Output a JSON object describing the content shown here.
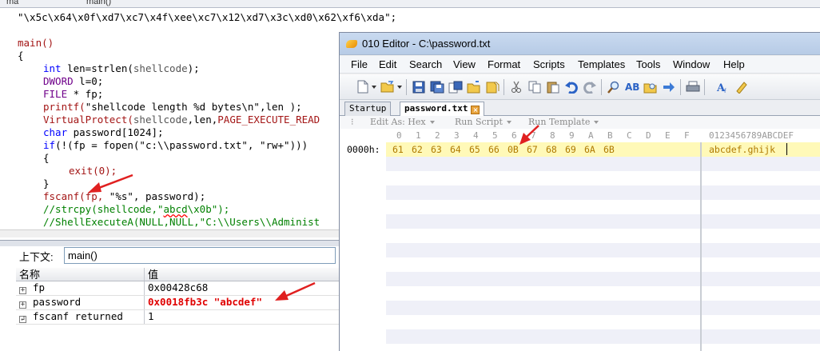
{
  "ide": {
    "topbar": {
      "item_a": "ma",
      "item_b": "main()"
    },
    "code_lines": {
      "l0": "\"\\x5c\\x64\\x0f\\xd7\\xc7\\x4f\\xee\\xc7\\x12\\xd7\\x3c\\xd0\\x62\\xf6\\xda\";",
      "l1": "main()",
      "l2": "{",
      "l3a": "int",
      "l3b": " len=strlen(",
      "l3c": "shellcode",
      "l3d": ");",
      "l4a": "DWORD",
      "l4b": " l=0;",
      "l5a": "FILE",
      "l5b": " * fp;",
      "l6a": "printf(",
      "l6b": "\"shellcode length %d bytes\\n\"",
      "l6c": ",len );",
      "l7a": "VirtualProtect(",
      "l7b": "shellcode",
      "l7c": ",len,",
      "l7d": "PAGE_EXECUTE_READ",
      "l8a": "char",
      "l8b": " password[1024];",
      "l9a": "if",
      "l9b": "(!(fp = fopen(",
      "l9c": "\"c:\\\\password.txt\"",
      "l9d": ", ",
      "l9e": "\"rw+\"",
      "l9f": ")))",
      "l10": "{",
      "l11": "exit(0);",
      "l12": "}",
      "l13a": "fscanf(fp, ",
      "l13b": "\"%s\"",
      "l13c": ", password);",
      "l14a": "//strcpy(shellcode,\"",
      "l14b": "abcd",
      "l14c": "\\x0b\");",
      "l15": "//ShellExecuteA(NULL,NULL,\"C:\\\\Users\\\\Administ"
    }
  },
  "locals": {
    "context_label": "上下文:",
    "context_value": "main()",
    "col_name": "名称",
    "col_value": "值",
    "rows": [
      {
        "name": "fp",
        "value": "0x00428c68",
        "highlight": false
      },
      {
        "name": "password",
        "value": "0x0018fb3c \"abcdef\"",
        "highlight": true
      },
      {
        "name": "fscanf returned",
        "value": "1",
        "highlight": false
      }
    ]
  },
  "editor": {
    "title": "010 Editor - C:\\password.txt",
    "menu": [
      "File",
      "Edit",
      "Search",
      "View",
      "Format",
      "Scripts",
      "Templates",
      "Tools",
      "Window",
      "Help"
    ],
    "tabs": {
      "startup": "Startup",
      "file": "password.txt"
    },
    "subtoolbar": {
      "edit_as": "Edit As: Hex",
      "run_script": "Run Script",
      "run_template": "Run Template"
    },
    "hex_header": [
      "0",
      "1",
      "2",
      "3",
      "4",
      "5",
      "6",
      "7",
      "8",
      "9",
      "A",
      "B",
      "C",
      "D",
      "E",
      "F"
    ],
    "text_header": "0123456789ABCDEF",
    "row_address": "0000h:",
    "row_bytes": [
      "61",
      "62",
      "63",
      "64",
      "65",
      "66",
      "0B",
      "67",
      "68",
      "69",
      "6A",
      "6B"
    ],
    "row_text": "abcdef.ghijk",
    "colors": {
      "highlight_row": "#fff9b8",
      "byte_text": "#b07a00",
      "alt_row": "#eff0f8"
    }
  },
  "annotations": {
    "arrow_color": "#e02020"
  }
}
